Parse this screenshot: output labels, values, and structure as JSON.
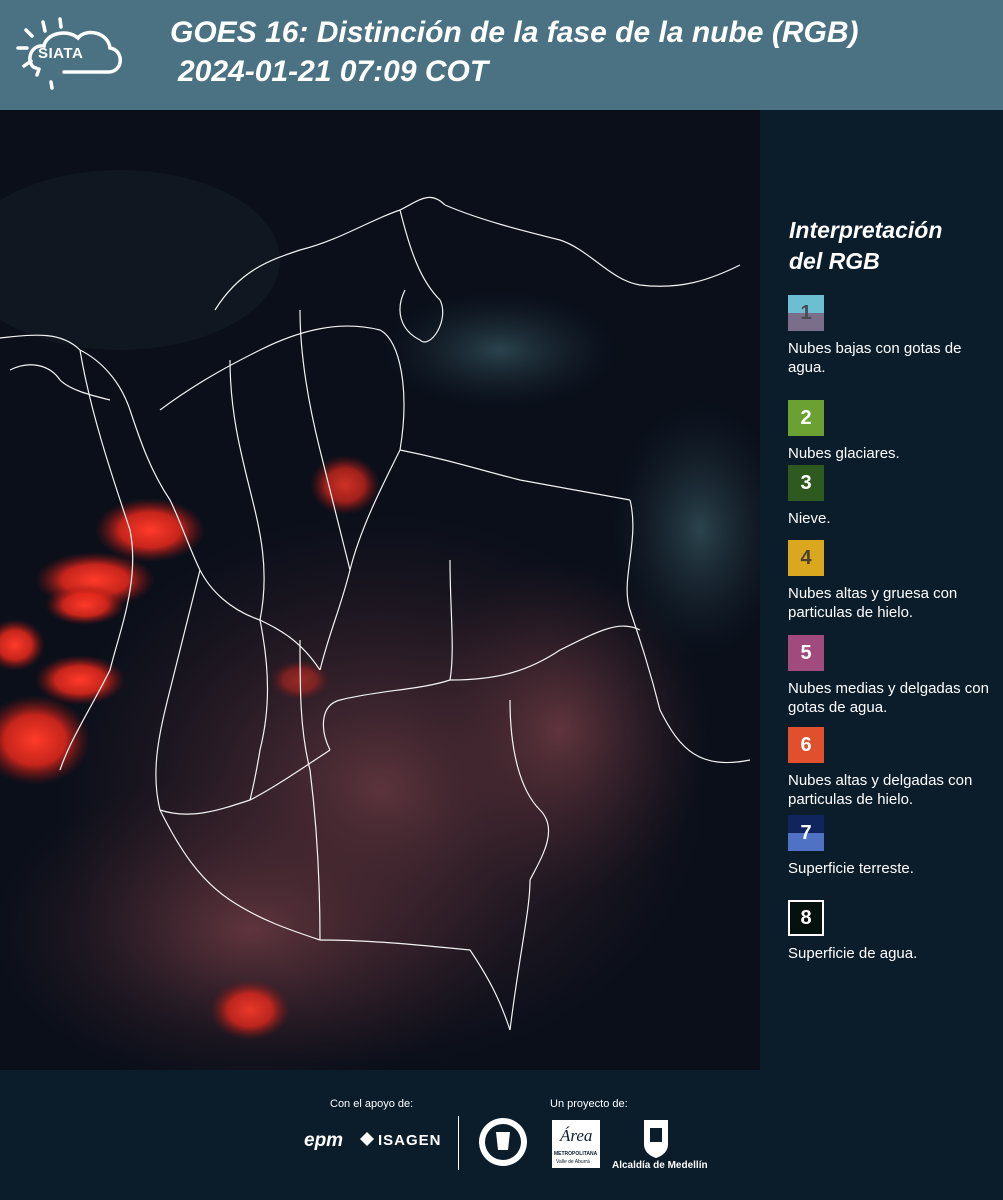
{
  "header": {
    "logo_text": "SIATA",
    "title": "GOES 16: Distinción de la fase de la nube (RGB)",
    "timestamp": "2024-01-21 07:09 COT",
    "background_color": "#4a7282"
  },
  "legend": {
    "title_line1": "Interpretación",
    "title_line2": "del RGB",
    "items": [
      {
        "number": "1",
        "label": "Nubes bajas con gotas de agua.",
        "color_top": "#6cbfd0",
        "color_bottom": "#7a6e8a",
        "num_color": "#4a4a55"
      },
      {
        "number": "2",
        "label": "Nubes glaciares.",
        "color": "#6aa132"
      },
      {
        "number": "3",
        "label": "Nieve.",
        "color": "#2f5a1f"
      },
      {
        "number": "4",
        "label": "Nubes altas y gruesa con particulas de hielo.",
        "color": "#d9a81f",
        "num_color": "#4a4030"
      },
      {
        "number": "5",
        "label": "Nubes medias y delgadas con gotas de agua.",
        "color": "#a14a7e"
      },
      {
        "number": "6",
        "label": "Nubes altas y delgadas con particulas de hielo.",
        "color": "#e0502c"
      },
      {
        "number": "7",
        "label": "Superficie terreste.",
        "color_top": "#10255e",
        "color_bottom": "#4f72c4"
      },
      {
        "number": "8",
        "label": "Superficie de agua.",
        "color": "#05110d",
        "border": "#ffffff"
      }
    ]
  },
  "footer": {
    "support_label": "Con el apoyo de:",
    "project_label": "Un proyecto de:",
    "sponsors": [
      "epm",
      "ISAGEN"
    ],
    "partners": {
      "area_logo_text": "Área",
      "area_name": "METROPOLITANA",
      "area_sub": "Valle de Aburrá",
      "alcaldia": "Alcaldía de Medellín"
    }
  }
}
